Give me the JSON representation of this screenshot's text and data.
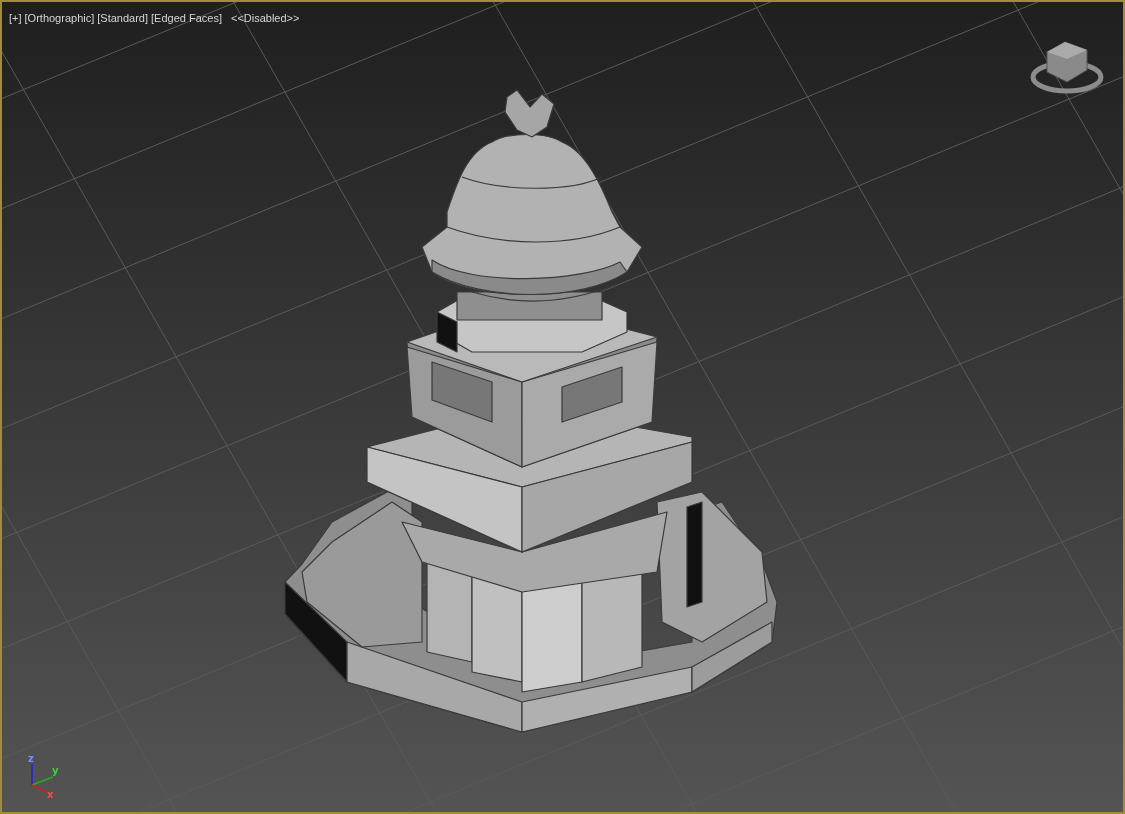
{
  "viewport": {
    "active": true,
    "labels": [
      {
        "text": "[+]"
      },
      {
        "text": "[Orthographic]"
      },
      {
        "text": "[Standard]"
      },
      {
        "text": "[Edged Faces]"
      },
      {
        "text": "<<Disabled>>"
      }
    ]
  },
  "axis_gizmo": {
    "labels": [
      {
        "text": "z"
      },
      {
        "text": "y"
      },
      {
        "text": "x"
      }
    ]
  }
}
